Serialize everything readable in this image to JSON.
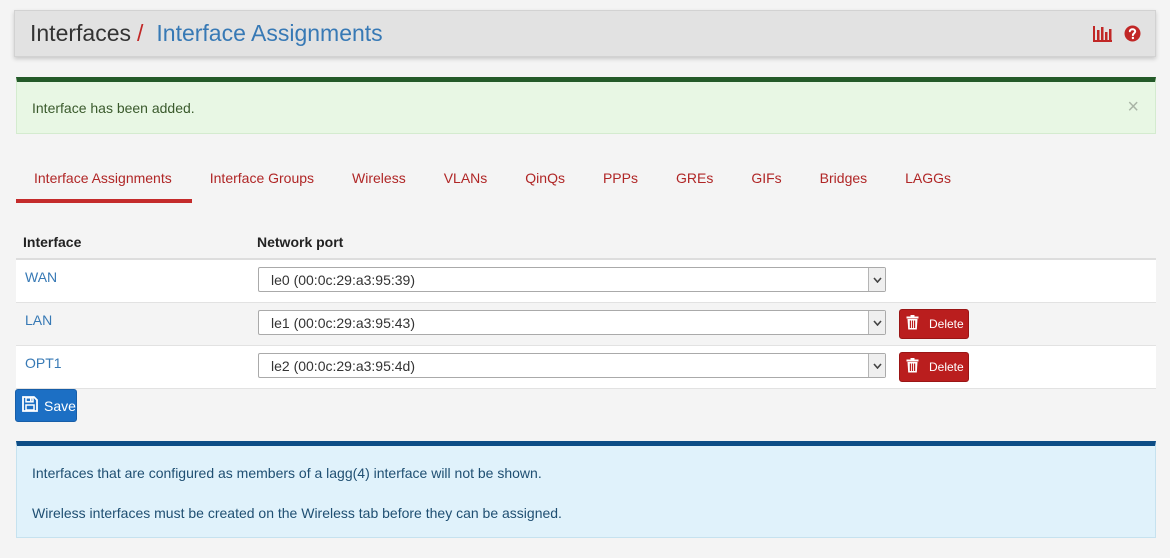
{
  "header": {
    "breadcrumb_root": "Interfaces",
    "separator": "/",
    "breadcrumb_page": "Interface Assignments",
    "icons": [
      "bar-chart-icon",
      "help-icon"
    ],
    "accent_color": "#c12726"
  },
  "alert_success": {
    "message": "Interface has been added.",
    "close": "×"
  },
  "tabs": [
    {
      "label": "Interface Assignments",
      "active": true
    },
    {
      "label": "Interface Groups"
    },
    {
      "label": "Wireless"
    },
    {
      "label": "VLANs"
    },
    {
      "label": "QinQs"
    },
    {
      "label": "PPPs"
    },
    {
      "label": "GREs"
    },
    {
      "label": "GIFs"
    },
    {
      "label": "Bridges"
    },
    {
      "label": "LAGGs"
    }
  ],
  "table": {
    "headers": [
      "Interface",
      "Network port"
    ],
    "rows": [
      {
        "interface": "WAN",
        "port": "le0 (00:0c:29:a3:95:39)",
        "delete": null
      },
      {
        "interface": "LAN",
        "port": "le1 (00:0c:29:a3:95:43)",
        "delete": "Delete"
      },
      {
        "interface": "OPT1",
        "port": "le2 (00:0c:29:a3:95:4d)",
        "delete": "Delete"
      }
    ]
  },
  "save_label": "Save",
  "alert_info": {
    "line1": "Interfaces that are configured as members of a lagg(4) interface will not be shown.",
    "line2": "Wireless interfaces must be created on the Wireless tab before they can be assigned."
  }
}
